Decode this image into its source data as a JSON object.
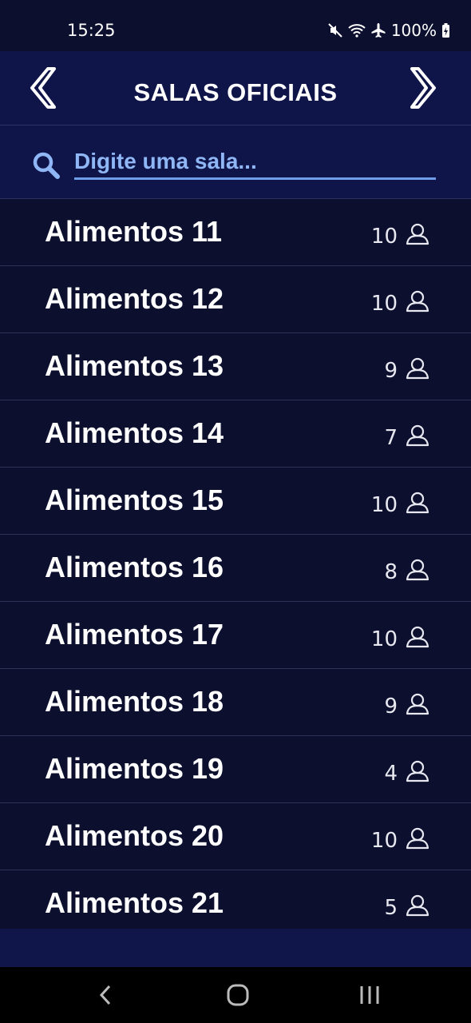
{
  "status": {
    "time": "15:25",
    "battery": "100%",
    "icons": [
      "mute-icon",
      "wifi-icon",
      "airplane-icon",
      "battery-charging-icon"
    ]
  },
  "header": {
    "title": "SALAS OFICIAIS",
    "prev_icon": "chevron-left-icon",
    "next_icon": "chevron-right-icon"
  },
  "search": {
    "placeholder": "Digite uma sala...",
    "value": ""
  },
  "rooms": [
    {
      "name": "Alimentos 11",
      "count": "10"
    },
    {
      "name": "Alimentos 12",
      "count": "10"
    },
    {
      "name": "Alimentos 13",
      "count": "9"
    },
    {
      "name": "Alimentos 14",
      "count": "7"
    },
    {
      "name": "Alimentos 15",
      "count": "10"
    },
    {
      "name": "Alimentos 16",
      "count": "8"
    },
    {
      "name": "Alimentos 17",
      "count": "10"
    },
    {
      "name": "Alimentos 18",
      "count": "9"
    },
    {
      "name": "Alimentos 19",
      "count": "4"
    },
    {
      "name": "Alimentos 20",
      "count": "10"
    },
    {
      "name": "Alimentos 21",
      "count": "5"
    }
  ],
  "colors": {
    "background": "#0c0f2e",
    "header": "#0f1449",
    "accent": "#8fb6f5",
    "divider": "#2f3358"
  }
}
